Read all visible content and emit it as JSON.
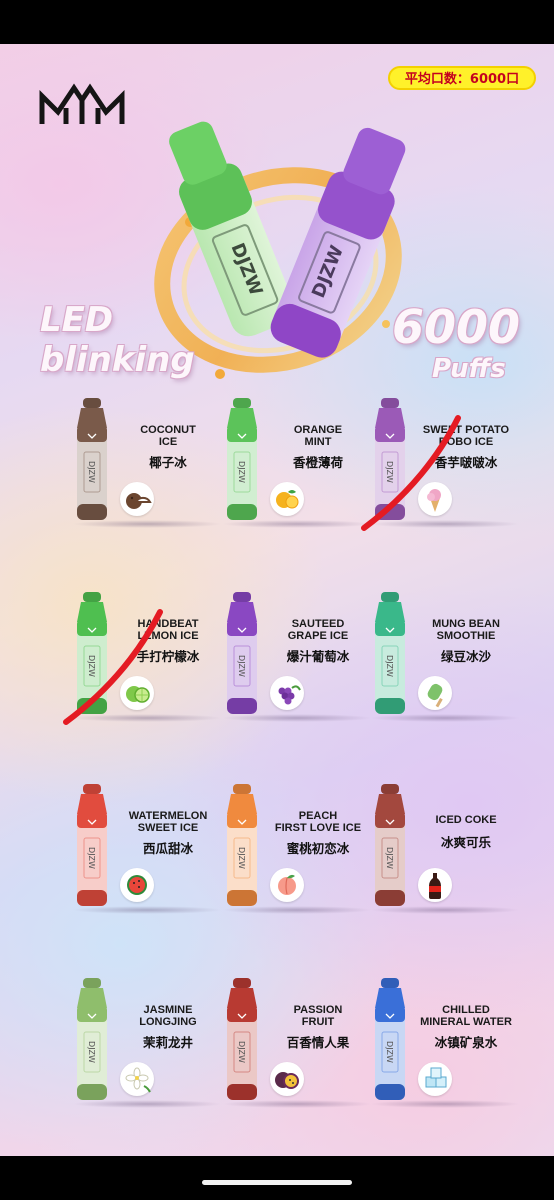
{
  "poster": {
    "badge": "平均口数：6000口",
    "hero_brand": "DJZW",
    "tagline_led": [
      "LED",
      "blinking"
    ],
    "puffs_number": "6000",
    "puffs_label": "Puffs"
  },
  "flavors": [
    {
      "name_en": [
        "COCONUT",
        "ICE"
      ],
      "name_cn": "椰子冰",
      "color": "#7a5a4a",
      "icon": "coconut-icon",
      "brand": "DJZW",
      "crossed_out": false
    },
    {
      "name_en": [
        "ORANGE",
        "MINT"
      ],
      "name_cn": "香橙薄荷",
      "color": "#5cc35a",
      "icon": "orange-icon",
      "brand": "DJZW",
      "crossed_out": false
    },
    {
      "name_en": [
        "SWEET POTATO",
        "BOBO ICE"
      ],
      "name_cn": "香芋啵啵冰",
      "color": "#9b5ab7",
      "icon": "ice-cream-icon",
      "brand": "DJZW",
      "crossed_out": true
    },
    {
      "name_en": [
        "HANDBEAT",
        "LEMON ICE"
      ],
      "name_cn": "手打柠檬冰",
      "color": "#4fbf50",
      "icon": "lime-icon",
      "brand": "DJZW",
      "crossed_out": true
    },
    {
      "name_en": [
        "SAUTEED",
        "GRAPE ICE"
      ],
      "name_cn": "爆汁葡萄冰",
      "color": "#8a48c2",
      "icon": "grape-icon",
      "brand": "DJZW",
      "crossed_out": false
    },
    {
      "name_en": [
        "MUNG BEAN",
        "SMOOTHIE"
      ],
      "name_cn": "绿豆冰沙",
      "color": "#3ab88a",
      "icon": "popsicle-icon",
      "brand": "DJZW",
      "crossed_out": false
    },
    {
      "name_en": [
        "WATERMELON",
        "SWEET ICE"
      ],
      "name_cn": "西瓜甜冰",
      "color": "#e14c3e",
      "icon": "watermelon-icon",
      "brand": "DJZW",
      "crossed_out": false
    },
    {
      "name_en": [
        "PEACH",
        "FIRST LOVE ICE"
      ],
      "name_cn": "蜜桃初恋冰",
      "color": "#f08a3e",
      "icon": "peach-icon",
      "brand": "DJZW",
      "crossed_out": false
    },
    {
      "name_en": [
        "ICED COKE"
      ],
      "name_cn": "冰爽可乐",
      "color": "#a3483e",
      "icon": "cola-bottle-icon",
      "brand": "DJZW",
      "crossed_out": false
    },
    {
      "name_en": [
        "JASMINE",
        "LONGJING"
      ],
      "name_cn": "茉莉龙井",
      "color": "#8fbe6c",
      "icon": "jasmine-flower-icon",
      "brand": "DJZW",
      "crossed_out": false
    },
    {
      "name_en": [
        "PASSION",
        "FRUIT"
      ],
      "name_cn": "百香情人果",
      "color": "#b83a32",
      "icon": "passion-fruit-icon",
      "brand": "DJZW",
      "crossed_out": false
    },
    {
      "name_en": [
        "CHILLED",
        "MINERAL WATER"
      ],
      "name_cn": "冰镇矿泉水",
      "color": "#3a6fd8",
      "icon": "ice-cubes-icon",
      "brand": "DJZW",
      "crossed_out": false
    }
  ]
}
